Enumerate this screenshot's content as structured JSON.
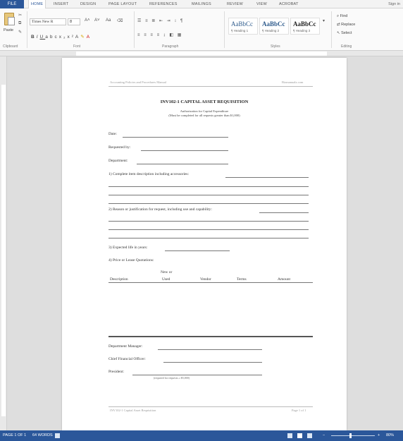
{
  "ribbon_tabs": [
    "FILE",
    "HOME",
    "INSERT",
    "DESIGN",
    "PAGE LAYOUT",
    "REFERENCES",
    "MAILINGS",
    "REVIEW",
    "VIEW",
    "ACROBAT"
  ],
  "sign_in": "Sign in",
  "clipboard": {
    "paste_label": "Paste",
    "group_label": "Clipboard"
  },
  "font": {
    "name": "Times New R",
    "size": "8",
    "group_label": "Font"
  },
  "paragraph": {
    "group_label": "Paragraph"
  },
  "styles": {
    "items": [
      {
        "sample": "AaBbCc",
        "name": "¶ Heading 1"
      },
      {
        "sample": "AaBbCc",
        "name": "¶ Heading 2"
      },
      {
        "sample": "AaBbCc",
        "name": "¶ Heading 3"
      }
    ],
    "group_label": "Styles"
  },
  "editing": {
    "find": "Find",
    "replace": "Replace",
    "select": "Select",
    "group_label": "Editing"
  },
  "document": {
    "header_left": "Accounting Policies and Procedures Manual",
    "header_right": "Bizmanualz.com",
    "title": "INV102-1 CAPITAL ASSET REQUISITION",
    "subtitle_1": "Authorization for Capital Expenditure",
    "subtitle_2": "(Must be completed for all requests greater than $1,000)",
    "date_label": "Date:",
    "requested_by_label": "Requested by:",
    "department_label": "Department:",
    "q1": "1) Complete item description including accessories:",
    "q2": "2) Reason or justification for request, including use and capability:",
    "q3": "3) Expected life in years:",
    "q4": "4) Price or Lease Quotations:",
    "table_headers": {
      "description": "Description",
      "new_or": "New or",
      "used": "Used",
      "vendor": "Vendor",
      "terms": "Terms",
      "amount": "Amount"
    },
    "sig_dept_manager": "Department Manager:",
    "sig_cfo": "Chief Financial Officer:",
    "sig_president": "President:",
    "sig_note": "(required for requests ≥ $5,000)",
    "footer_left": "INV102-1 Capital Asset Requisition",
    "footer_right": "Page 1 of 1"
  },
  "status": {
    "page": "PAGE 1 OF 1",
    "words": "64 WORDS",
    "zoom": "80%"
  },
  "colors": {
    "accent": "#2b579a"
  }
}
